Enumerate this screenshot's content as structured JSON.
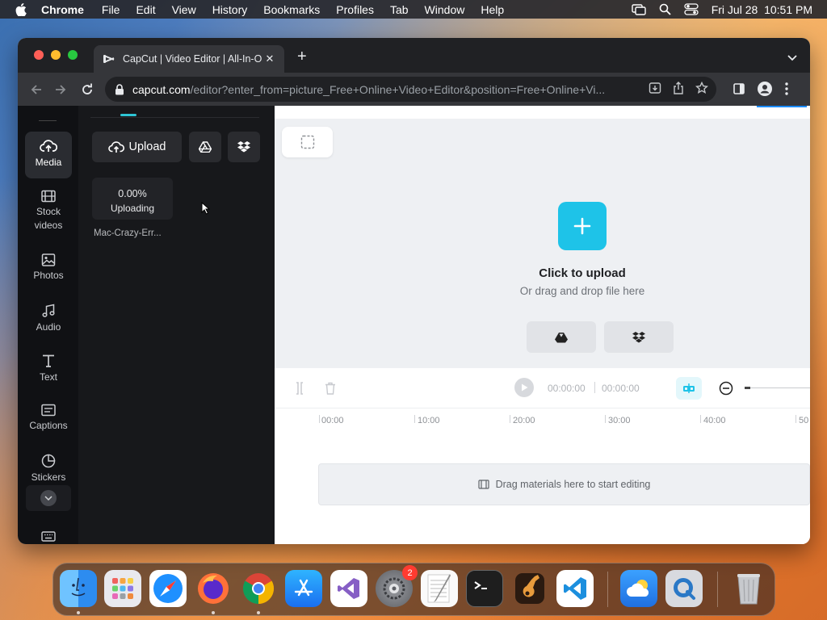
{
  "menubar": {
    "app": "Chrome",
    "items": [
      "File",
      "Edit",
      "View",
      "History",
      "Bookmarks",
      "Profiles",
      "Tab",
      "Window",
      "Help"
    ],
    "datetime": "Fri Jul 28  10:51 PM"
  },
  "browser": {
    "tab_title": "CapCut | Video Editor | All-In-O",
    "url_host": "capcut.com",
    "url_path": "/editor?enter_from=picture_Free+Online+Video+Editor&position=Free+Online+Vi..."
  },
  "sidebar": {
    "items": [
      {
        "label": "Media",
        "icon": "cloud-upload-icon"
      },
      {
        "label": "Stock\nvideos",
        "icon": "film-icon"
      },
      {
        "label": "Photos",
        "icon": "image-icon"
      },
      {
        "label": "Audio",
        "icon": "music-note-icon"
      },
      {
        "label": "Text",
        "icon": "text-t-icon"
      },
      {
        "label": "Captions",
        "icon": "captions-icon"
      },
      {
        "label": "Stickers",
        "icon": "sticker-icon"
      }
    ]
  },
  "media_panel": {
    "upload_label": "Upload",
    "upload_progress": "0.00%",
    "upload_status": "Uploading",
    "file_name": "Mac-Crazy-Err..."
  },
  "canvas": {
    "click_to_upload": "Click to upload",
    "drag_drop": "Or drag and drop file here"
  },
  "timeline": {
    "current_time": "00:00:00",
    "total_time": "00:00:00",
    "ruler_labels": [
      "00:00",
      "10:00",
      "20:00",
      "30:00",
      "40:00",
      "50"
    ],
    "drop_hint": "Drag materials here to start editing"
  },
  "dock": {
    "settings_badge": "2",
    "apps": [
      "finder",
      "launchpad",
      "safari",
      "firefox",
      "chrome",
      "app-store",
      "visual-studio",
      "system-settings",
      "textedit",
      "terminal",
      "garageband",
      "vscode",
      "weather",
      "quicktime",
      "trash"
    ]
  },
  "colors": {
    "accent": "#1ec3e8",
    "media_tab_underline": "#2ec5d5",
    "dark_panel": "#17181b"
  }
}
